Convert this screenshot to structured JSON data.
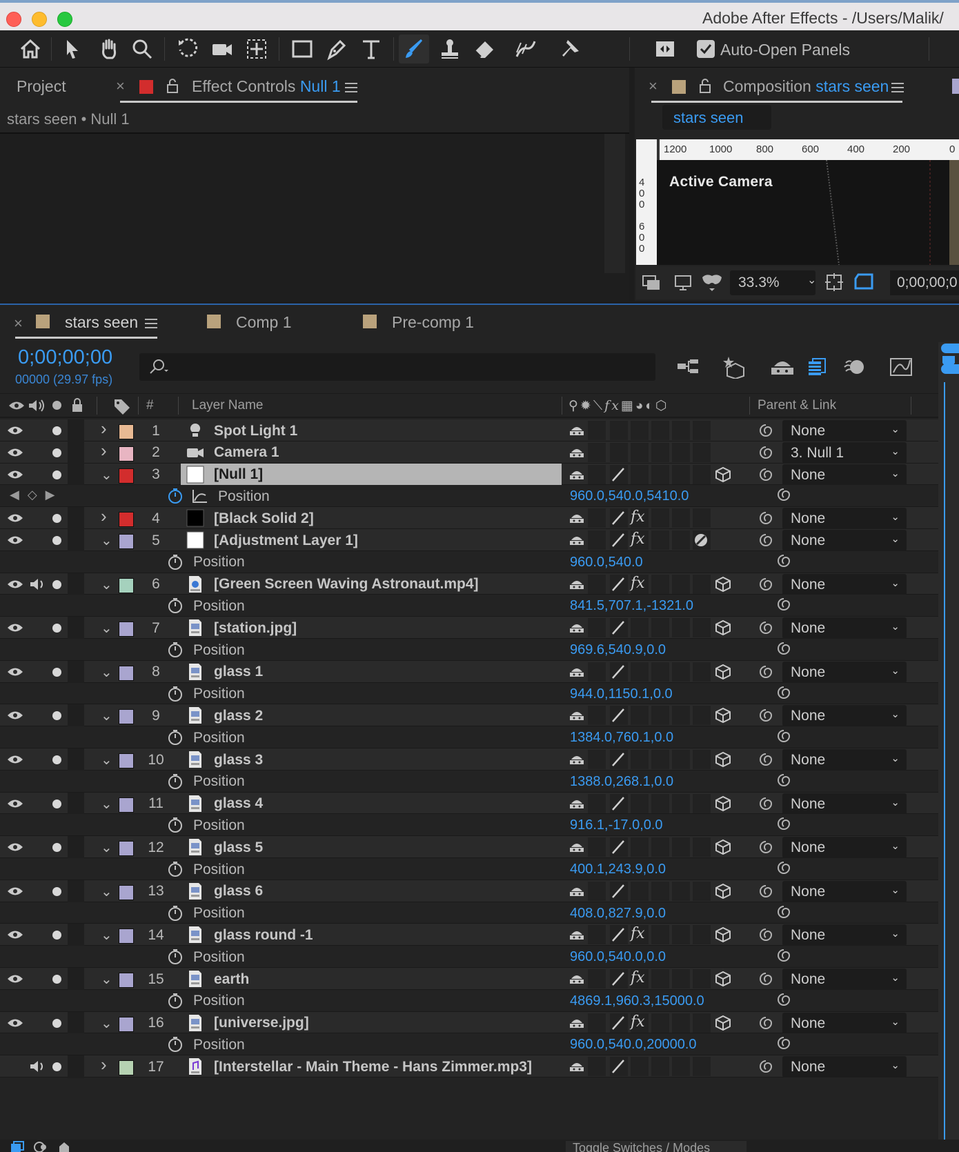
{
  "window": {
    "title": "Adobe After Effects - /Users/Malik/"
  },
  "toolbar": {
    "tools": [
      "home-icon",
      "selection-icon",
      "hand-icon",
      "zoom-icon",
      "rotate-icon",
      "camera-icon",
      "pan-behind-icon",
      "rectangle-icon",
      "pen-icon",
      "type-icon",
      "brush-icon",
      "clone-stamp-icon",
      "eraser-icon",
      "roto-brush-icon",
      "puppet-pin-icon"
    ],
    "active_tool": "brush-icon",
    "auto_open_label": "Auto-Open Panels",
    "auto_open_checked": true
  },
  "effect_controls": {
    "project_tab": "Project",
    "tab_prefix": "Effect Controls",
    "tab_target": "Null 1",
    "swatch_color": "#d22d2d",
    "breadcrumb": "stars seen • Null 1"
  },
  "composition": {
    "tab_prefix": "Composition",
    "tab_target": "stars seen",
    "swatch_color": "#b9a27c",
    "comp_label": "stars seen",
    "ruler_h": [
      "1200",
      "1000",
      "800",
      "600",
      "400",
      "200",
      "0"
    ],
    "ruler_v": [
      "4",
      "0",
      "0",
      "6",
      "0",
      "0"
    ],
    "viewer_label": "Active Camera",
    "zoom": "33.3%",
    "time": "0;00;00;0"
  },
  "timeline": {
    "tabs": [
      {
        "label": "stars seen",
        "swatch": "#b9a27c",
        "active": true
      },
      {
        "label": "Comp 1",
        "swatch": "#b9a27c",
        "active": false
      },
      {
        "label": "Pre-comp 1",
        "swatch": "#b9a27c",
        "active": false
      }
    ],
    "timecode": "0;00;00;00",
    "frames": "00000 (29.97 fps)",
    "columns": {
      "hash": "#",
      "layer_name": "Layer Name",
      "parent": "Parent & Link"
    },
    "footer": "Toggle Switches / Modes",
    "rows": [
      {
        "kind": "layer",
        "index": "1",
        "name": "Spot Light 1",
        "swatch": "#e8b993",
        "icon": "light-icon",
        "expanded": false,
        "parent": "None",
        "audio": false,
        "eye": true,
        "slash": false,
        "fx": false,
        "cube": false
      },
      {
        "kind": "layer",
        "index": "2",
        "name": "Camera 1",
        "swatch": "#e8b5c2",
        "icon": "camera-layer-icon",
        "expanded": false,
        "parent": "3. Null 1",
        "audio": false,
        "eye": true,
        "slash": false,
        "fx": false,
        "cube": false
      },
      {
        "kind": "layer",
        "index": "3",
        "name": "[Null 1]",
        "swatch": "#d22d2d",
        "icon": "white-solid-icon",
        "expanded": true,
        "parent": "None",
        "audio": false,
        "eye": true,
        "slash": true,
        "fx": false,
        "cube": true,
        "selected": true
      },
      {
        "kind": "prop",
        "label": "Position",
        "value": "960.0,540.0,5410.0",
        "keyframed": true
      },
      {
        "kind": "layer",
        "index": "4",
        "name": "[Black Solid 2]",
        "swatch": "#d22d2d",
        "icon": "black-solid-icon",
        "expanded": false,
        "parent": "None",
        "audio": false,
        "eye": true,
        "slash": true,
        "fx": true,
        "cube": false
      },
      {
        "kind": "layer",
        "index": "5",
        "name": "[Adjustment Layer 1]",
        "swatch": "#a9a5cf",
        "icon": "white-solid-icon",
        "expanded": true,
        "parent": "None",
        "audio": false,
        "eye": true,
        "slash": true,
        "fx": true,
        "cube": false,
        "adjust": true
      },
      {
        "kind": "prop",
        "label": "Position",
        "value": "960.0,540.0"
      },
      {
        "kind": "layer",
        "index": "6",
        "name": "[Green Screen Waving Astronaut.mp4]",
        "swatch": "#a5d1bd",
        "icon": "video-file-icon",
        "expanded": true,
        "parent": "None",
        "audio": true,
        "eye": true,
        "slash": true,
        "fx": true,
        "cube": true
      },
      {
        "kind": "prop",
        "label": "Position",
        "value": "841.5,707.1,-1321.0"
      },
      {
        "kind": "layer",
        "index": "7",
        "name": "[station.jpg]",
        "swatch": "#a9a5cf",
        "icon": "image-file-icon",
        "expanded": true,
        "parent": "None",
        "audio": false,
        "eye": true,
        "slash": true,
        "fx": false,
        "cube": true
      },
      {
        "kind": "prop",
        "label": "Position",
        "value": "969.6,540.9,0.0"
      },
      {
        "kind": "layer",
        "index": "8",
        "name": "glass 1",
        "swatch": "#a9a5cf",
        "icon": "image-file-icon",
        "expanded": true,
        "parent": "None",
        "audio": false,
        "eye": true,
        "slash": true,
        "fx": false,
        "cube": true
      },
      {
        "kind": "prop",
        "label": "Position",
        "value": "944.0,1150.1,0.0"
      },
      {
        "kind": "layer",
        "index": "9",
        "name": "glass 2",
        "swatch": "#a9a5cf",
        "icon": "image-file-icon",
        "expanded": true,
        "parent": "None",
        "audio": false,
        "eye": true,
        "slash": true,
        "fx": false,
        "cube": true
      },
      {
        "kind": "prop",
        "label": "Position",
        "value": "1384.0,760.1,0.0"
      },
      {
        "kind": "layer",
        "index": "10",
        "name": "glass 3",
        "swatch": "#a9a5cf",
        "icon": "image-file-icon",
        "expanded": true,
        "parent": "None",
        "audio": false,
        "eye": true,
        "slash": true,
        "fx": false,
        "cube": true
      },
      {
        "kind": "prop",
        "label": "Position",
        "value": "1388.0,268.1,0.0"
      },
      {
        "kind": "layer",
        "index": "11",
        "name": "glass 4",
        "swatch": "#a9a5cf",
        "icon": "image-file-icon",
        "expanded": true,
        "parent": "None",
        "audio": false,
        "eye": true,
        "slash": true,
        "fx": false,
        "cube": true
      },
      {
        "kind": "prop",
        "label": "Position",
        "value": "916.1,-17.0,0.0"
      },
      {
        "kind": "layer",
        "index": "12",
        "name": "glass 5",
        "swatch": "#a9a5cf",
        "icon": "image-file-icon",
        "expanded": true,
        "parent": "None",
        "audio": false,
        "eye": true,
        "slash": true,
        "fx": false,
        "cube": true
      },
      {
        "kind": "prop",
        "label": "Position",
        "value": "400.1,243.9,0.0"
      },
      {
        "kind": "layer",
        "index": "13",
        "name": "glass 6",
        "swatch": "#a9a5cf",
        "icon": "image-file-icon",
        "expanded": true,
        "parent": "None",
        "audio": false,
        "eye": true,
        "slash": true,
        "fx": false,
        "cube": true
      },
      {
        "kind": "prop",
        "label": "Position",
        "value": "408.0,827.9,0.0"
      },
      {
        "kind": "layer",
        "index": "14",
        "name": "glass round -1",
        "swatch": "#a9a5cf",
        "icon": "image-file-icon",
        "expanded": true,
        "parent": "None",
        "audio": false,
        "eye": true,
        "slash": true,
        "fx": true,
        "cube": true
      },
      {
        "kind": "prop",
        "label": "Position",
        "value": "960.0,540.0,0.0"
      },
      {
        "kind": "layer",
        "index": "15",
        "name": "earth",
        "swatch": "#a9a5cf",
        "icon": "image-file-icon",
        "expanded": true,
        "parent": "None",
        "audio": false,
        "eye": true,
        "slash": true,
        "fx": true,
        "cube": true
      },
      {
        "kind": "prop",
        "label": "Position",
        "value": "4869.1,960.3,15000.0"
      },
      {
        "kind": "layer",
        "index": "16",
        "name": "[universe.jpg]",
        "swatch": "#a9a5cf",
        "icon": "image-file-icon",
        "expanded": true,
        "parent": "None",
        "audio": false,
        "eye": true,
        "slash": true,
        "fx": true,
        "cube": true
      },
      {
        "kind": "prop",
        "label": "Position",
        "value": "960.0,540.0,20000.0"
      },
      {
        "kind": "layer",
        "index": "17",
        "name": "[Interstellar - Main Theme - Hans Zimmer.mp3]",
        "swatch": "#b6d2b2",
        "icon": "audio-file-icon",
        "expanded": false,
        "parent": "None",
        "audio": true,
        "eye": false,
        "slash": true,
        "fx": false,
        "cube": false
      }
    ]
  }
}
